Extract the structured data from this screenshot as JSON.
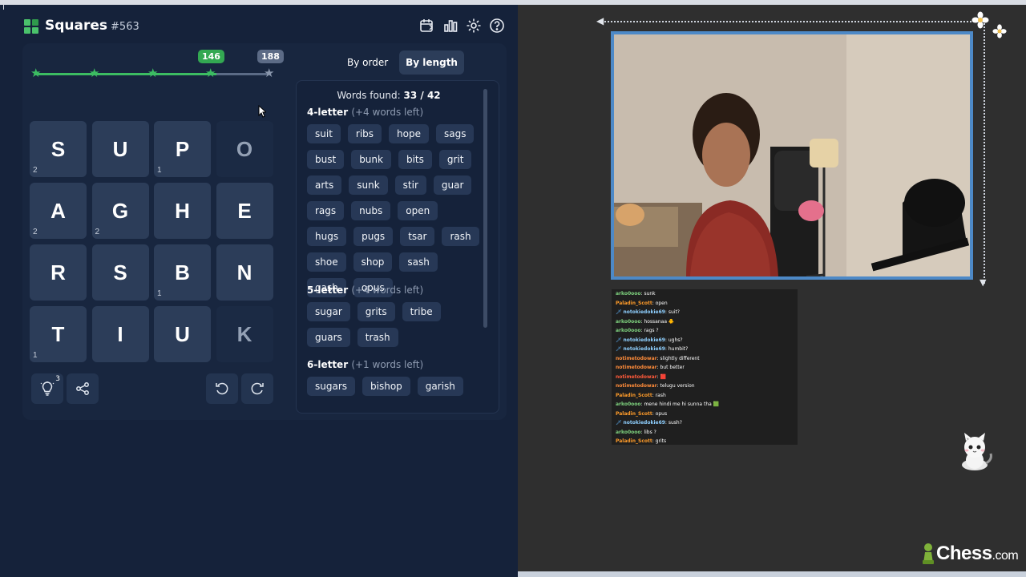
{
  "game": {
    "title": "Squares",
    "number": "#563",
    "header_icons": [
      "calendar-icon",
      "stats-icon",
      "gear-icon",
      "help-icon"
    ],
    "progress": {
      "current": "146",
      "max": "188",
      "fraction": 0.776,
      "stars_reached": 4,
      "stars_total": 5
    },
    "tiles": [
      {
        "letter": "S",
        "count": "2",
        "dim": false
      },
      {
        "letter": "U",
        "count": "",
        "dim": false
      },
      {
        "letter": "P",
        "count": "1",
        "dim": false
      },
      {
        "letter": "O",
        "count": "",
        "dim": true
      },
      {
        "letter": "A",
        "count": "2",
        "dim": false
      },
      {
        "letter": "G",
        "count": "2",
        "dim": false
      },
      {
        "letter": "H",
        "count": "",
        "dim": false
      },
      {
        "letter": "E",
        "count": "",
        "dim": false
      },
      {
        "letter": "R",
        "count": "",
        "dim": false
      },
      {
        "letter": "S",
        "count": "",
        "dim": false
      },
      {
        "letter": "B",
        "count": "1",
        "dim": false
      },
      {
        "letter": "N",
        "count": "",
        "dim": false
      },
      {
        "letter": "T",
        "count": "1",
        "dim": false
      },
      {
        "letter": "I",
        "count": "",
        "dim": false
      },
      {
        "letter": "U",
        "count": "",
        "dim": false
      },
      {
        "letter": "K",
        "count": "",
        "dim": true
      }
    ],
    "hint_count": "3",
    "tabs": {
      "by_order": "By order",
      "by_length": "By length"
    },
    "found_label": "Words found:",
    "found_value": "33 / 42",
    "sections": [
      {
        "label": "4-letter",
        "left": "(+4 words left)",
        "words": [
          "suit",
          "ribs",
          "hope",
          "sags",
          "bust",
          "bunk",
          "bits",
          "grit",
          "arts",
          "sunk",
          "stir",
          "guar",
          "rags",
          "nubs",
          "open",
          "hugs",
          "pugs",
          "tsar",
          "rash",
          "shoe",
          "shop",
          "sash",
          "gash",
          "opus"
        ]
      },
      {
        "label": "5-letter",
        "left": "(+4 words left)",
        "words": [
          "sugar",
          "grits",
          "tribe",
          "guars",
          "trash"
        ]
      },
      {
        "label": "6-letter",
        "left": "(+1 words left)",
        "words": [
          "sugars",
          "bishop",
          "garish"
        ]
      }
    ]
  },
  "chat": [
    {
      "user": "arko0ooo",
      "badge": false,
      "color": "#7fd37f",
      "text": "sunk"
    },
    {
      "user": "Paladin_Scott",
      "badge": false,
      "color": "#ff9c2a",
      "text": "open"
    },
    {
      "user": "notokiedokie69",
      "badge": true,
      "color": "#8fd0ff",
      "text": "suit?"
    },
    {
      "user": "arko0ooo",
      "badge": false,
      "color": "#7fd37f",
      "text": "hossanaa 🐥"
    },
    {
      "user": "arko0ooo",
      "badge": false,
      "color": "#7fd37f",
      "text": "rags ?"
    },
    {
      "user": "notokiedokie69",
      "badge": true,
      "color": "#8fd0ff",
      "text": "ughs?"
    },
    {
      "user": "notokiedokie69",
      "badge": true,
      "color": "#8fd0ff",
      "text": "humbit?"
    },
    {
      "user": "notimetodowar",
      "badge": false,
      "color": "#ff8c3a",
      "text": "slightly different"
    },
    {
      "user": "notimetodowar",
      "badge": false,
      "color": "#ff8c3a",
      "text": "but better"
    },
    {
      "user": "notimetodowar",
      "badge": false,
      "color": "#ff5a3a",
      "text": "🟥"
    },
    {
      "user": "notimetodowar",
      "badge": false,
      "color": "#ff8c3a",
      "text": "telugu version"
    },
    {
      "user": "Paladin_Scott",
      "badge": false,
      "color": "#ff9c2a",
      "text": "rash"
    },
    {
      "user": "arko0ooo",
      "badge": false,
      "color": "#7fd37f",
      "text": "mene hindi me hi sunna tha 🟩"
    },
    {
      "user": "Paladin_Scott",
      "badge": false,
      "color": "#ff9c2a",
      "text": "opus"
    },
    {
      "user": "notokiedokie69",
      "badge": true,
      "color": "#8fd0ff",
      "text": "sush?"
    },
    {
      "user": "arko0ooo",
      "badge": false,
      "color": "#7fd37f",
      "text": "libs ?"
    },
    {
      "user": "Paladin_Scott",
      "badge": false,
      "color": "#ff9c2a",
      "text": "grits"
    }
  ],
  "brand": {
    "name": "Chess",
    "suffix": ".com"
  },
  "colors": {
    "accent_green": "#3cbc62",
    "panel": "#15223a",
    "tile": "#2c3d59",
    "cam_border": "#4d89c7"
  }
}
